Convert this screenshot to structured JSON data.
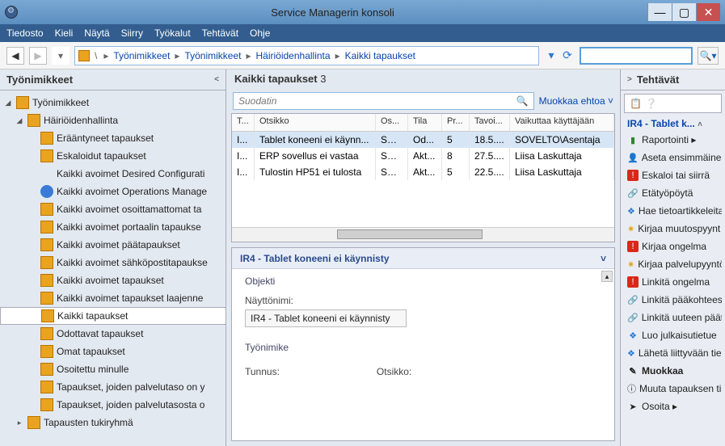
{
  "window": {
    "title": "Service Managerin konsoli"
  },
  "menu": [
    "Tiedosto",
    "Kieli",
    "Näytä",
    "Siirry",
    "Työkalut",
    "Tehtävät",
    "Ohje"
  ],
  "breadcrumb": [
    "Työnimikkeet",
    "Työnimikkeet",
    "Häiriöidenhallinta",
    "Kaikki tapaukset"
  ],
  "leftnav": {
    "title": "Työnimikkeet",
    "tree": {
      "root": "Työnimikkeet",
      "group": "Häiriöidenhallinta",
      "items": [
        "Erääntyneet tapaukset",
        "Eskaloidut tapaukset",
        "Kaikki avoimet Desired Configurati",
        "Kaikki avoimet Operations Manage",
        "Kaikki avoimet osoittamattomat ta",
        "Kaikki avoimet portaalin tapaukse",
        "Kaikki avoimet päätapaukset",
        "Kaikki avoimet sähköpostitapaukse",
        "Kaikki avoimet tapaukset",
        "Kaikki avoimet tapaukset laajenne",
        "Kaikki tapaukset",
        "Odottavat tapaukset",
        "Omat tapaukset",
        "Osoitettu minulle",
        "Tapaukset, joiden palvelutaso on y",
        "Tapaukset, joiden palvelutasosta o"
      ],
      "selectedIndex": 10,
      "footer": "Tapausten tukiryhmä"
    }
  },
  "view": {
    "title": "Kaikki tapaukset",
    "count": "3",
    "filterPlaceholder": "Suodatin",
    "editLink": "Muokkaa ehtoa",
    "columns": [
      "T...",
      "Otsikko",
      "Os...",
      "Tila",
      "Pr...",
      "Tavoi...",
      "Vaikuttaa käyttäjään"
    ],
    "rows": [
      {
        "id": "I...",
        "title": "Tablet koneeni ei käynn...",
        "owner": "SO...",
        "state": "Od...",
        "pri": "5",
        "due": "18.5....",
        "user": "SOVELTO\\Asentaja",
        "selected": true
      },
      {
        "id": "I...",
        "title": "ERP sovellus ei vastaa",
        "owner": "SO...",
        "state": "Akt...",
        "pri": "8",
        "due": "27.5....",
        "user": "Liisa Laskuttaja"
      },
      {
        "id": "I...",
        "title": "Tulostin HP51 ei tulosta",
        "owner": "SO...",
        "state": "Akt...",
        "pri": "5",
        "due": "22.5....",
        "user": "Liisa Laskuttaja"
      }
    ]
  },
  "detail": {
    "header": "IR4 - Tablet koneeni ei käynnisty",
    "section1": "Objekti",
    "label1": "Näyttönimi:",
    "value1": "IR4 - Tablet koneeni ei käynnisty",
    "section2": "Työnimike",
    "label2": "Tunnus:",
    "label3": "Otsikko:"
  },
  "tasks": {
    "title": "Tehtävät",
    "group": "IR4 - Tablet k...",
    "items": [
      {
        "icon": "green",
        "label": "Raportointi ▸"
      },
      {
        "icon": "orange",
        "label": "Aseta ensimmäinen"
      },
      {
        "icon": "red",
        "label": "Eskaloi tai siirrä"
      },
      {
        "icon": "link",
        "label": "Etätyöpöytä"
      },
      {
        "icon": "blue",
        "label": "Hae tietoartikkeleita"
      },
      {
        "icon": "star",
        "label": "Kirjaa muutospyynt"
      },
      {
        "icon": "red",
        "label": "Kirjaa ongelma"
      },
      {
        "icon": "star",
        "label": "Kirjaa palvelupyyntö"
      },
      {
        "icon": "red",
        "label": "Linkitä ongelma"
      },
      {
        "icon": "link",
        "label": "Linkitä pääkohteese"
      },
      {
        "icon": "link",
        "label": "Linkitä uuteen päät"
      },
      {
        "icon": "blue",
        "label": "Luo julkaisutietue"
      },
      {
        "icon": "blue",
        "label": "Lähetä liittyvään tie"
      },
      {
        "icon": "edit",
        "label": "Muokkaa",
        "bold": true
      },
      {
        "icon": "info",
        "label": "Muuta tapauksen ti"
      },
      {
        "icon": "arrow",
        "label": "Osoita ▸"
      }
    ]
  }
}
